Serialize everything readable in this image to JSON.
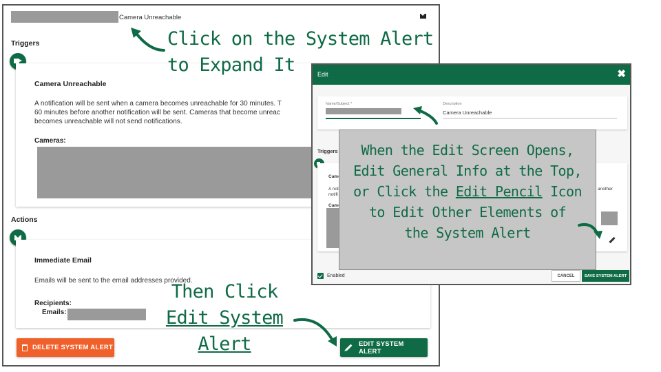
{
  "main": {
    "header_title": "Camera Unreachable",
    "header_icon": "mail-icon",
    "triggers_label": "Triggers",
    "trigger_card": {
      "title": "Camera Unreachable",
      "description": [
        "A notification will be sent when a camera becomes unreachable for 30 minutes. T",
        "60 minutes before another notification will be sent. Cameras that become unreac",
        "becomes unreachable will not send notifications."
      ],
      "cameras_label": "Cameras:"
    },
    "actions_label": "Actions",
    "action_card": {
      "title": "Immediate Email",
      "description": "Emails will be sent to the email addresses provided.",
      "recipients_label": "Recipients:",
      "emails_label": "Emails:"
    },
    "delete_button": "DELETE SYSTEM ALERT",
    "edit_button": "EDIT SYSTEM ALERT"
  },
  "dialog": {
    "title": "Edit",
    "close": "✖",
    "name_label": "Name/Subject *",
    "description_label": "Description",
    "description_value": "Camera Unreachable",
    "triggers_label": "Triggers",
    "card_fragments": {
      "title_frag": "Came",
      "line1_left": "A noti",
      "line1_right": "another",
      "line2_left": "notifi",
      "line3_left": "Came"
    },
    "enabled_label": "Enabled",
    "cancel_button": "CANCEL",
    "save_button": "SAVE SYSTEM ALERT"
  },
  "annotations": {
    "top": [
      "Click on the System Alert",
      "to Expand It"
    ],
    "callout": {
      "line1": "When the Edit Screen Opens,",
      "line2": "Edit General Info at the Top,",
      "line3_pre": "or Click the ",
      "line3_link": "Edit Pencil",
      "line3_post": " Icon",
      "line4": "to Edit Other Elements of",
      "line5": "the System Alert"
    },
    "bottom": [
      "Then Click",
      "Edit System",
      "Alert"
    ]
  },
  "colors": {
    "brand_green": "#0f6b45",
    "delete_orange": "#f0602a",
    "redaction_gray": "#9a9a9a",
    "callout_gray": "#c6c6c6"
  }
}
